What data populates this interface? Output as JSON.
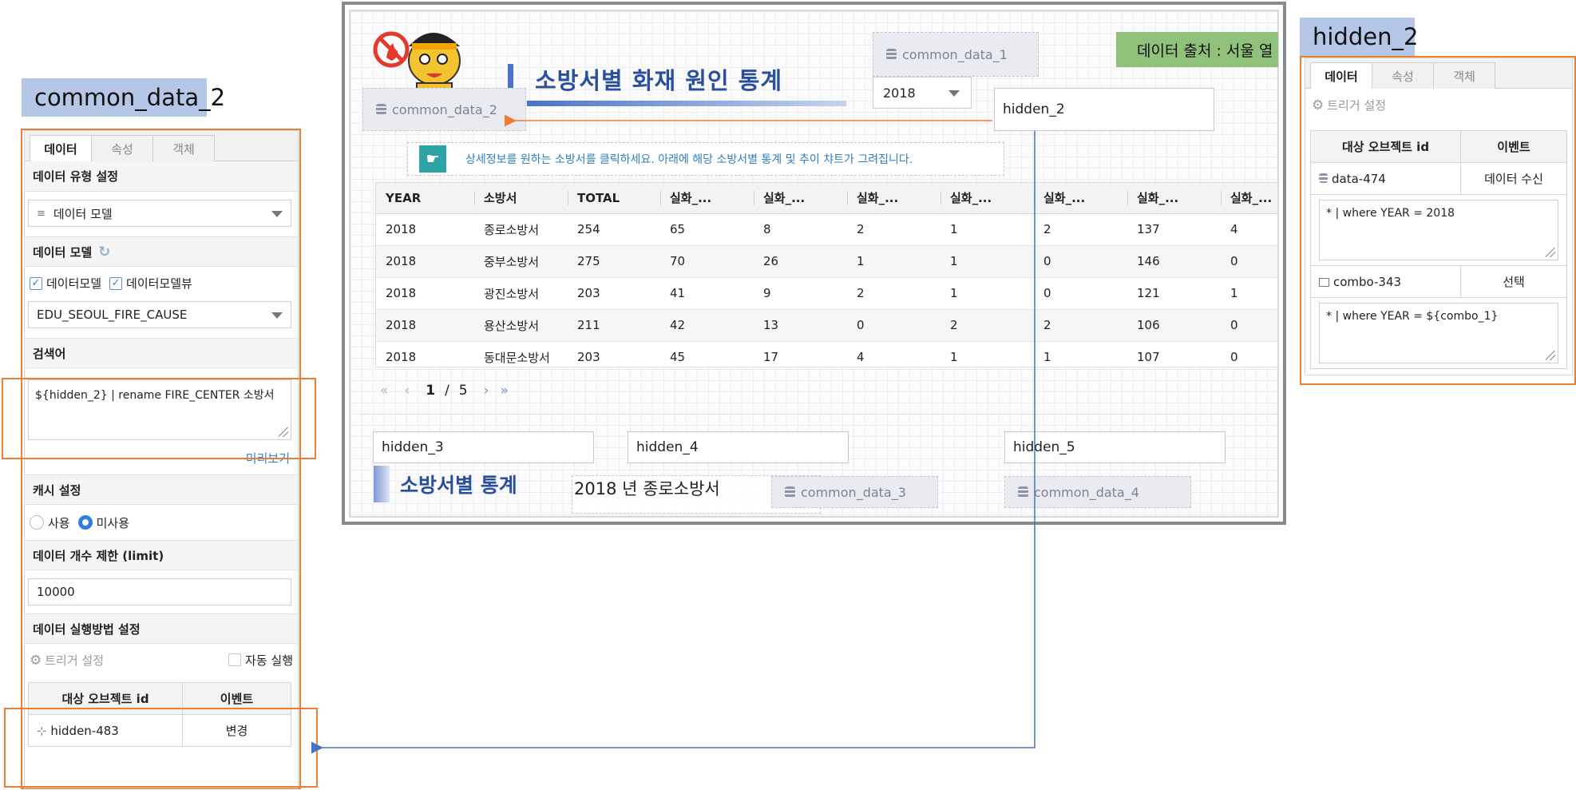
{
  "left": {
    "tag": "common_data_2",
    "tabs": [
      "데이터",
      "속성",
      "객체"
    ],
    "sections": {
      "data_type": "데이터 유형 설정",
      "data_model": "데이터 모델",
      "search": "검색어",
      "cache": "캐시 설정",
      "limit": "데이터 개수 제한 (limit)",
      "exec": "데이터 실행방법 설정"
    },
    "data_type_value": "데이터 모델",
    "checkbox_model": "데이터모델",
    "checkbox_model_view": "데이터모델뷰",
    "model_value": "EDU_SEOUL_FIRE_CAUSE",
    "search_query": "${hidden_2}  | rename FIRE_CENTER 소방서",
    "preview": "미리보기",
    "cache_use": "사용",
    "cache_unused": "미사용",
    "limit_value": "10000",
    "trigger": "트리거 설정",
    "auto_run": "자동 실행",
    "table_headers": [
      "대상 오브젝트 id",
      "이벤트"
    ],
    "rows": [
      {
        "id": "hidden-483",
        "event": "변경"
      }
    ]
  },
  "center": {
    "title": "소방서별 화재 원인 통계",
    "chip_common_1": "common_data_1",
    "chip_common_2": "common_data_2",
    "source_label": "데이터 출처 : 서울 열",
    "combo_year": "2018",
    "hidden_2": "hidden_2",
    "hint": "상세정보를 원하는 소방서를 클릭하세요. 아래에 해당 소방서별 통계 및 추이  챠트가 그려집니다.",
    "grid_headers": [
      "YEAR",
      "소방서",
      "TOTAL",
      "실화_...",
      "실화_...",
      "실화_...",
      "실화_...",
      "실화_...",
      "실화_...",
      "실화_..."
    ],
    "grid_rows": [
      [
        "2018",
        "종로소방서",
        "254",
        "65",
        "8",
        "2",
        "1",
        "2",
        "137",
        "4"
      ],
      [
        "2018",
        "중부소방서",
        "275",
        "70",
        "26",
        "1",
        "1",
        "0",
        "146",
        "0"
      ],
      [
        "2018",
        "광진소방서",
        "203",
        "41",
        "9",
        "2",
        "1",
        "0",
        "121",
        "1"
      ],
      [
        "2018",
        "용산소방서",
        "211",
        "42",
        "13",
        "0",
        "2",
        "2",
        "106",
        "0"
      ],
      [
        "2018",
        "동대문소방서",
        "203",
        "45",
        "17",
        "4",
        "1",
        "1",
        "107",
        "0"
      ]
    ],
    "pager": {
      "current": "1",
      "sep": "/",
      "total": "5"
    },
    "hidden_3": "hidden_3",
    "hidden_4": "hidden_4",
    "hidden_5": "hidden_5",
    "section_title": "소방서별 통계",
    "selection_text": "2018 년 종로소방서",
    "chip_common_3": "common_data_3",
    "chip_common_4": "common_data_4"
  },
  "right": {
    "tag": "hidden_2",
    "tabs": [
      "데이터",
      "속성",
      "객체"
    ],
    "trigger": "트리거 설정",
    "table_headers": [
      "대상 오브젝트 id",
      "이벤트"
    ],
    "rows": [
      {
        "id": "data-474",
        "event": "데이터 수신",
        "query": "* | where  YEAR = 2018"
      },
      {
        "id": "combo-343",
        "event": "선택",
        "query": "* | where  YEAR = ${combo_1}"
      }
    ]
  },
  "colors": {
    "accent_orange": "#ed7d31",
    "link_blue": "#4472c4",
    "source_green": "#8fc17a",
    "tag_blue": "#b4c7e7"
  }
}
